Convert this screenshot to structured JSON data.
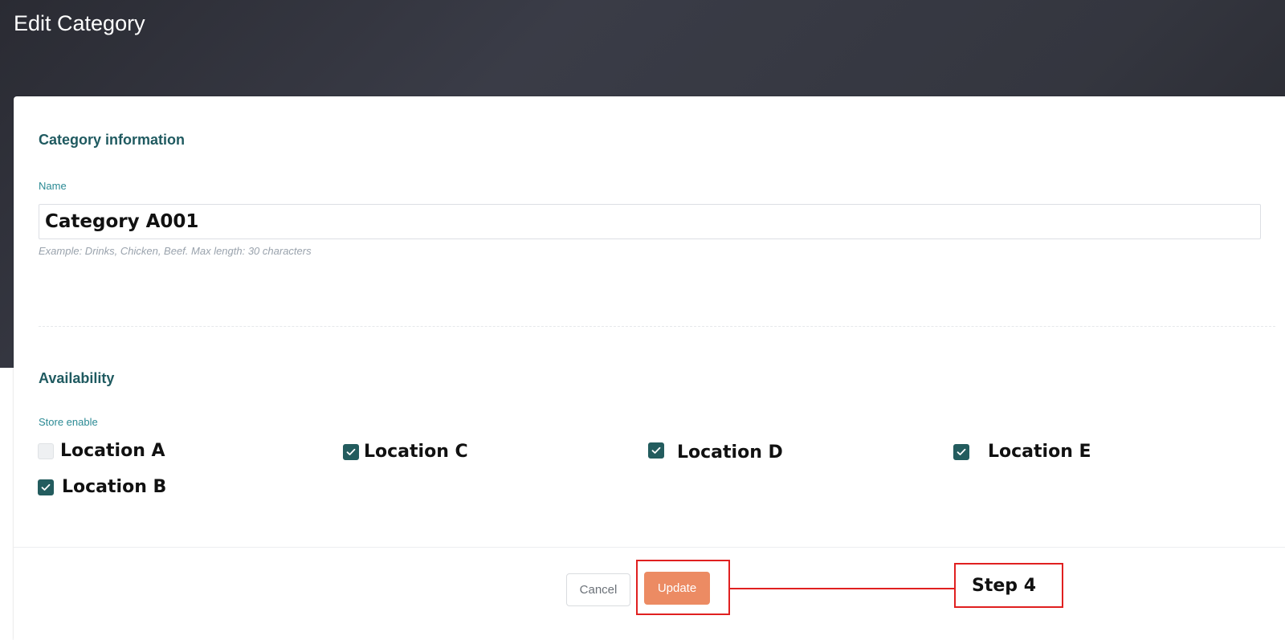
{
  "page": {
    "title": "Edit Category"
  },
  "category_info": {
    "section_title": "Category information",
    "name_label": "Name",
    "name_value": "Category A001",
    "name_help": "Example: Drinks, Chicken, Beef. Max length: 30 characters"
  },
  "availability": {
    "section_title": "Availability",
    "store_enable_label": "Store enable",
    "locations": [
      {
        "label": "Location A",
        "checked": false
      },
      {
        "label": "Location B",
        "checked": true
      },
      {
        "label": "Location C",
        "checked": true
      },
      {
        "label": "Location D",
        "checked": true
      },
      {
        "label": "Location E",
        "checked": true
      }
    ]
  },
  "footer": {
    "cancel_label": "Cancel",
    "update_label": "Update"
  },
  "annotation": {
    "step_label": "Step 4",
    "color": "#e02020"
  },
  "colors": {
    "accent": "#235c5e",
    "section_title": "#1f5a60",
    "label": "#2b8a94",
    "update_button": "#ec8b63"
  }
}
